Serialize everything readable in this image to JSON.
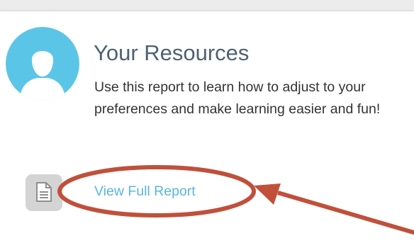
{
  "resources_card": {
    "title": "Your Resources",
    "description": "Use this report to learn how to adjust to your preferences and make learning easier and fun!",
    "avatar_icon": "user-silhouette-icon",
    "report_icon": "document-icon",
    "report_link_label": "View Full Report"
  },
  "annotation": {
    "shape": "ellipse",
    "pointer": "arrow",
    "color": "#c0503a"
  },
  "colors": {
    "avatar": "#5bc5e8",
    "title": "#4e6272",
    "link": "#5bb5e0",
    "icon_tile": "#d4d4d4"
  }
}
